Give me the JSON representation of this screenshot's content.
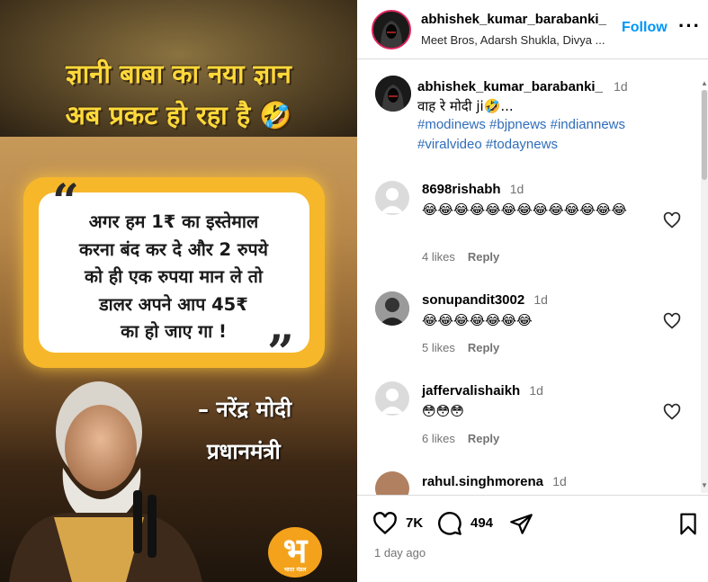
{
  "media": {
    "headline_line1": "ज्ञानी बाबा का नया ज्ञान",
    "headline_line2": "अब प्रकट हो रहा है 🤣",
    "quote_lines": [
      "अगर हम 1₹ का इस्तेमाल",
      "करना बंद कर दे और 2 रुपये",
      "को ही एक रुपया मान ले तो",
      "डालर अपने आप 45₹",
      "का हो जाए गा !"
    ],
    "attribution_name": "– नरेंद्र मोदी",
    "attribution_title": "प्रधानमंत्री",
    "logo_letter": "भ",
    "logo_caption": "भारत मंडल"
  },
  "header": {
    "username": "abhishek_kumar_barabanki_",
    "subtitle": "Meet Bros, Adarsh Shukla, Divya ...",
    "follow_label": "Follow",
    "more_label": "···"
  },
  "caption": {
    "username": "abhishek_kumar_barabanki_",
    "time": "1d",
    "text": "वाह रे मोदी ji🤣...",
    "tags_line1": [
      "#modinews",
      "#bjpnews",
      "#indiannews"
    ],
    "tags_line2": [
      "#viralvideo",
      "#todaynews"
    ]
  },
  "comments": [
    {
      "username": "8698rishabh",
      "time": "1d",
      "text": "😂😂😂😂😂😂😂😂😂😂😂😂😂",
      "likes": "4 likes",
      "reply": "Reply"
    },
    {
      "username": "sonupandit3002",
      "time": "1d",
      "text": "😂😂😂😂😂😂😂",
      "likes": "5 likes",
      "reply": "Reply"
    },
    {
      "username": "jaffervalishaikh",
      "time": "1d",
      "text": "😳😳😳",
      "likes": "6 likes",
      "reply": "Reply"
    },
    {
      "username": "rahul.singhmorena",
      "time": "1d"
    }
  ],
  "actions": {
    "likes_count": "7K",
    "comments_count": "494",
    "posted_ago": "1 day ago"
  },
  "colors": {
    "accent_blue": "#0095f6",
    "hashtag": "#2f6dba",
    "muted": "#737373"
  }
}
